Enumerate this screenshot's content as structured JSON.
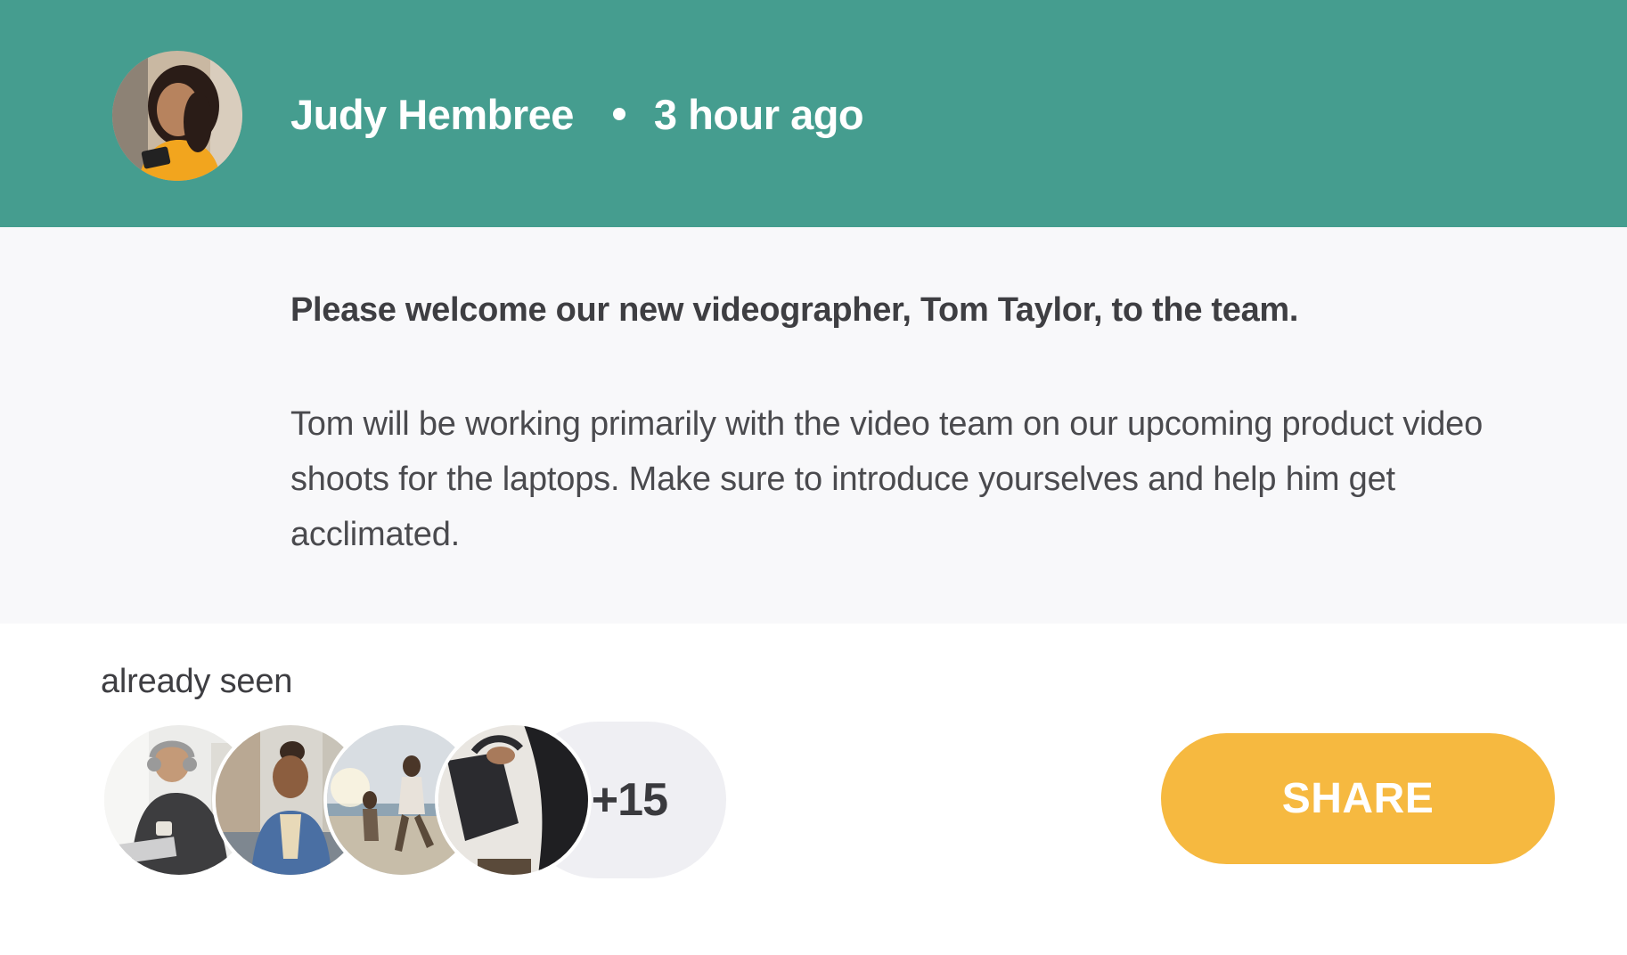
{
  "post": {
    "author": {
      "name": "Judy Hembree",
      "avatar": "avatar-woman-with-phone"
    },
    "time": "3 hour ago",
    "headline": "Please welcome our new videographer, Tom Taylor, to the team.",
    "paragraph": "Tom will be working primarily with the video team on our upcoming product video shoots for the laptops. Make sure to introduce yourselves and help him get acclimated."
  },
  "seen": {
    "label": "already seen",
    "viewers": [
      "viewer-man-headphones",
      "viewer-woman-denim-jacket",
      "viewer-people-on-beach",
      "viewer-person-with-bag"
    ],
    "more_count": "+15"
  },
  "actions": {
    "share_label": "SHARE"
  },
  "colors": {
    "header_bg": "#459d8f",
    "body_bg": "#f8f8fa",
    "share_button": "#f6b940",
    "more_pill": "#efeff3"
  }
}
